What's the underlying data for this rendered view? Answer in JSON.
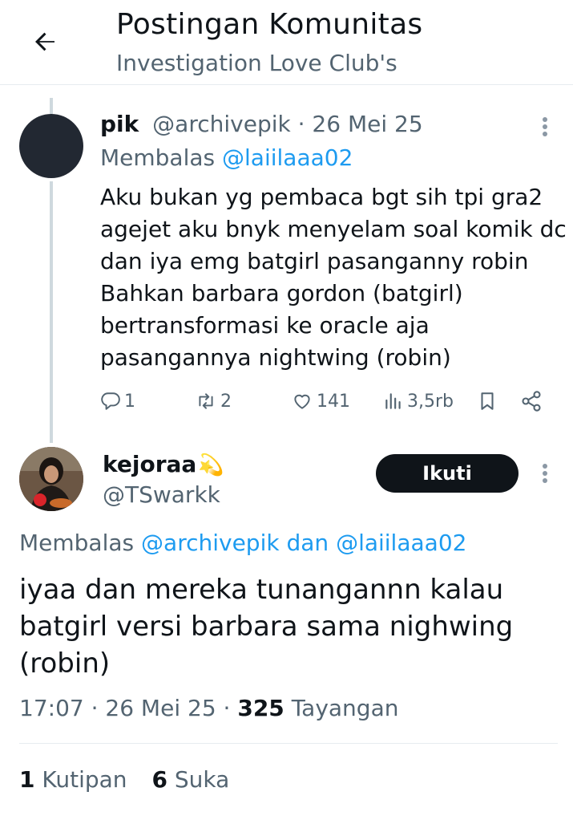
{
  "header": {
    "title": "Postingan Komunitas",
    "subtitle": "Investigation Love Club's"
  },
  "post1": {
    "name": "pik",
    "handle": "@archivepik",
    "separator": " · ",
    "date": "26 Mei 25",
    "reply_prefix": "Membalas ",
    "reply_mention": "@laiilaaa02",
    "body_lines": [
      "Aku bukan yg pembaca bgt sih tpi gra2",
      "agejet aku bnyk menyelam soal komik dc",
      "dan iya emg batgirl pasanganny robin",
      "Bahkan barbara gordon (batgirl)",
      "bertransformasi ke oracle aja",
      "pasangannya nightwing (robin)"
    ],
    "actions": {
      "replies": "1",
      "reposts": "2",
      "likes": "141",
      "views": "3,5rb"
    }
  },
  "post2": {
    "name": "kejoraa",
    "name_emoji": "💫",
    "handle": "@TSwarkk",
    "follow_label": "Ikuti",
    "reply_prefix": "Membalas ",
    "reply_mention1": "@archivepik",
    "reply_and": " dan ",
    "reply_mention2": "@laiilaaa02",
    "body_lines": [
      "iyaa dan mereka tunangannn kalau",
      "batgirl versi barbara sama nighwing",
      "(robin)"
    ],
    "time": "17:07",
    "separator": " · ",
    "date": "26 Mei 25",
    "views_count": "325",
    "views_label": " Tayangan",
    "quotes_count": "1",
    "quotes_label": " Kutipan",
    "likes_count": "6",
    "likes_label": " Suka"
  },
  "icons": {
    "back": "arrow-left-icon",
    "more": "more-vertical-icon",
    "reply": "reply-icon",
    "repost": "repost-icon",
    "like": "heart-icon",
    "views": "views-chart-icon",
    "bookmark": "bookmark-icon",
    "share": "share-icon"
  },
  "colors": {
    "text": "#0f1419",
    "secondary": "#536471",
    "mention": "#1d9bf0",
    "button_bg": "#0f1419",
    "thread_line": "#cfd9de"
  }
}
